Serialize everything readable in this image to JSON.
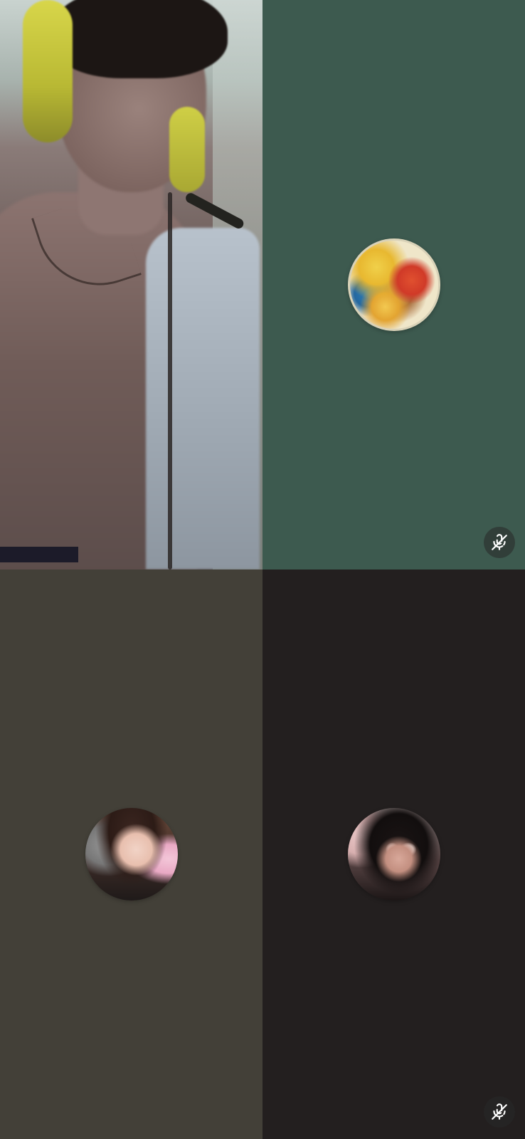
{
  "call": {
    "participants": [
      {
        "type": "video",
        "muted": false
      },
      {
        "type": "avatar",
        "avatar": "anime-artwork-avatar",
        "muted": true,
        "tile_color": "#3d5a4f"
      },
      {
        "type": "avatar",
        "avatar": "profile-photo-avatar",
        "muted": false,
        "tile_color": "#434038"
      },
      {
        "type": "avatar",
        "avatar": "profile-photo-sunglasses-avatar",
        "muted": true,
        "tile_color": "#231f1f"
      }
    ],
    "icons": {
      "muted": "mic-off-icon"
    }
  }
}
